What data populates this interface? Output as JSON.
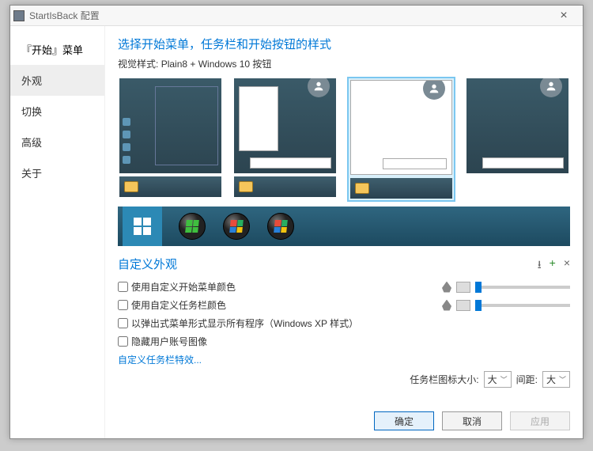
{
  "window": {
    "title": "StartIsBack 配置"
  },
  "sidebar": {
    "items": [
      {
        "label": "『开始』菜单"
      },
      {
        "label": "外观"
      },
      {
        "label": "切换"
      },
      {
        "label": "高级"
      },
      {
        "label": "关于"
      }
    ]
  },
  "main": {
    "heading": "选择开始菜单，任务栏和开始按钮的样式",
    "visual_label": "视觉样式:",
    "visual_value": "Plain8 + Windows 10 按钮"
  },
  "custom": {
    "title": "自定义外观",
    "checks": [
      "使用自定义开始菜单颜色",
      "使用自定义任务栏颜色",
      "以弹出式菜单形式显示所有程序（Windows XP 样式）",
      "隐藏用户账号图像"
    ],
    "link": "自定义任务栏特效..."
  },
  "taskbar_opts": {
    "icon_size_label": "任务栏图标大小:",
    "icon_size_value": "大",
    "gap_label": "间距:",
    "gap_value": "大"
  },
  "footer": {
    "ok": "确定",
    "cancel": "取消",
    "apply": "应用"
  }
}
